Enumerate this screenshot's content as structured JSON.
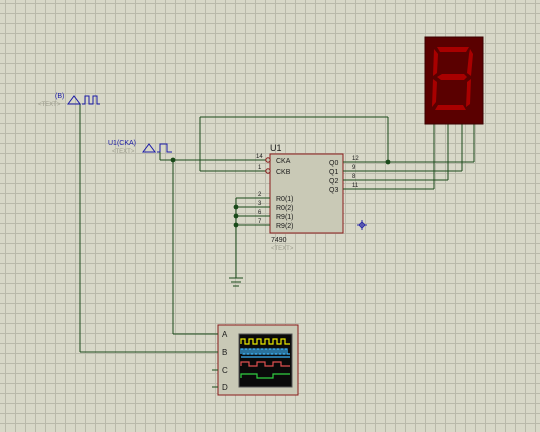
{
  "generator_b": {
    "label": "(B)",
    "text_placeholder": "<TEXT>"
  },
  "generator_u1": {
    "label": "U1(CKA)",
    "text_placeholder": "<TEXT>"
  },
  "counter": {
    "ref": "U1",
    "part": "7490",
    "text_placeholder": "<TEXT>",
    "pins_left": [
      {
        "num": "14",
        "name": "CKA"
      },
      {
        "num": "1",
        "name": "CKB"
      },
      {
        "num": "2",
        "name": "R0(1)"
      },
      {
        "num": "3",
        "name": "R0(2)"
      },
      {
        "num": "6",
        "name": "R9(1)"
      },
      {
        "num": "7",
        "name": "R9(2)"
      }
    ],
    "pins_right": [
      {
        "num": "12",
        "name": "Q0"
      },
      {
        "num": "9",
        "name": "Q1"
      },
      {
        "num": "8",
        "name": "Q2"
      },
      {
        "num": "11",
        "name": "Q3"
      }
    ]
  },
  "scope": {
    "channels": [
      "A",
      "B",
      "C",
      "D"
    ]
  },
  "display": {
    "digit": "8",
    "segment_color": "#a80000",
    "body_color": "#5a0000"
  }
}
